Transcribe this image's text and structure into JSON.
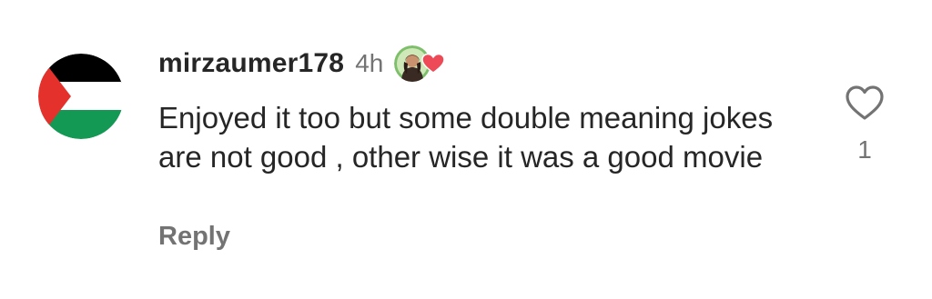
{
  "comment": {
    "username": "mirzaumer178",
    "time": "4h",
    "text": "Enjoyed it too but some double meaning jokes are not good , other wise it was a good movie",
    "reply_label": "Reply",
    "like_count": "1",
    "avatar_icon": "palestine-flag-icon",
    "liked_by_creator_icon": "creator-liked-heart-icon",
    "like_icon": "heart-outline-icon"
  },
  "colors": {
    "text_primary": "#262626",
    "text_secondary": "#737373",
    "heart_red": "#ed4956",
    "flag_black": "#000000",
    "flag_green": "#149954",
    "flag_red": "#e4312b"
  }
}
